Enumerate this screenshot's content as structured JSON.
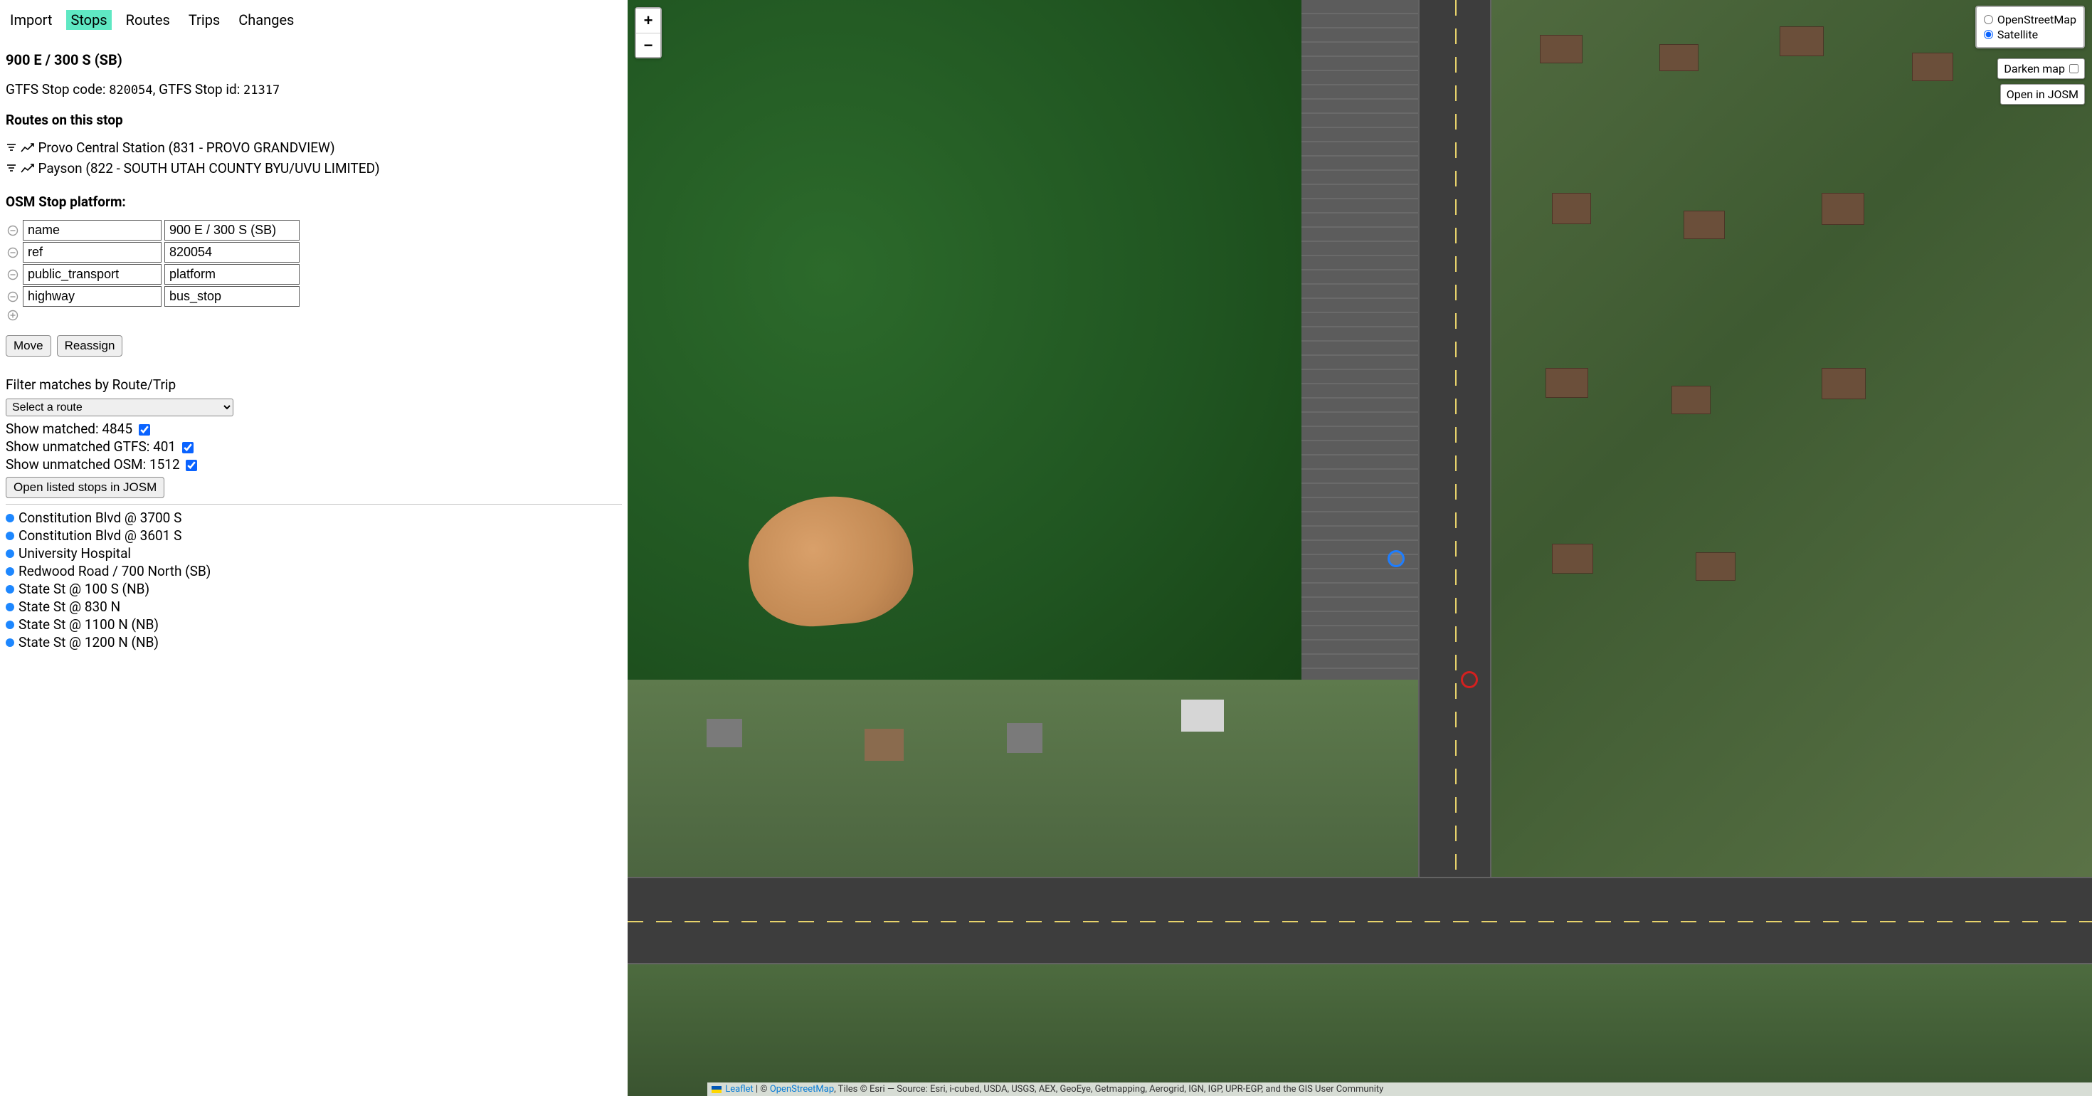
{
  "nav": {
    "items": [
      "Import",
      "Stops",
      "Routes",
      "Trips",
      "Changes"
    ],
    "active_index": 1
  },
  "stop": {
    "title": "900 E / 300 S (SB)",
    "gtfs_code_label": "GTFS Stop code:",
    "gtfs_code": "820054",
    "gtfs_id_label": "GTFS Stop id:",
    "gtfs_id": "21317"
  },
  "routes_heading": "Routes on this stop",
  "routes": [
    {
      "text": "Provo Central Station (831 - PROVO GRANDVIEW)"
    },
    {
      "text": "Payson (822 - SOUTH UTAH COUNTY BYU/UVU LIMITED)"
    }
  ],
  "osm_heading": "OSM Stop platform:",
  "tags": [
    {
      "k": "name",
      "v": "900 E / 300 S (SB)"
    },
    {
      "k": "ref",
      "v": "820054"
    },
    {
      "k": "public_transport",
      "v": "platform"
    },
    {
      "k": "highway",
      "v": "bus_stop"
    }
  ],
  "buttons": {
    "move": "Move",
    "reassign": "Reassign"
  },
  "filter": {
    "heading": "Filter matches by Route/Trip",
    "select_placeholder": "Select a route",
    "matched_label": "Show matched:",
    "matched_count": "4845",
    "unmatched_gtfs_label": "Show unmatched GTFS:",
    "unmatched_gtfs_count": "401",
    "unmatched_osm_label": "Show unmatched OSM:",
    "unmatched_osm_count": "1512",
    "open_josm": "Open listed stops in JOSM"
  },
  "stop_list": [
    "Constitution Blvd @ 3700 S",
    "Constitution Blvd @ 3601 S",
    "University Hospital",
    "Redwood Road / 700 North (SB)",
    "State St @ 100 S (NB)",
    "State St @ 830 N",
    "State St @ 1100 N (NB)",
    "State St @ 1200 N (NB)"
  ],
  "map": {
    "layers": {
      "osm": "OpenStreetMap",
      "sat": "Satellite",
      "selected": "sat"
    },
    "darken_label": "Darken map",
    "darken_checked": false,
    "open_josm": "Open in JOSM",
    "zoom_in": "+",
    "zoom_out": "−",
    "attribution_prefix_link": "Leaflet",
    "attribution_osm": "OpenStreetMap",
    "attribution_rest": ", Tiles © Esri — Source: Esri, i-cubed, USDA, USGS, AEX, GeoEye, Getmapping, Aerogrid, IGN, IGP, UPR-EGP, and the GIS User Community"
  }
}
